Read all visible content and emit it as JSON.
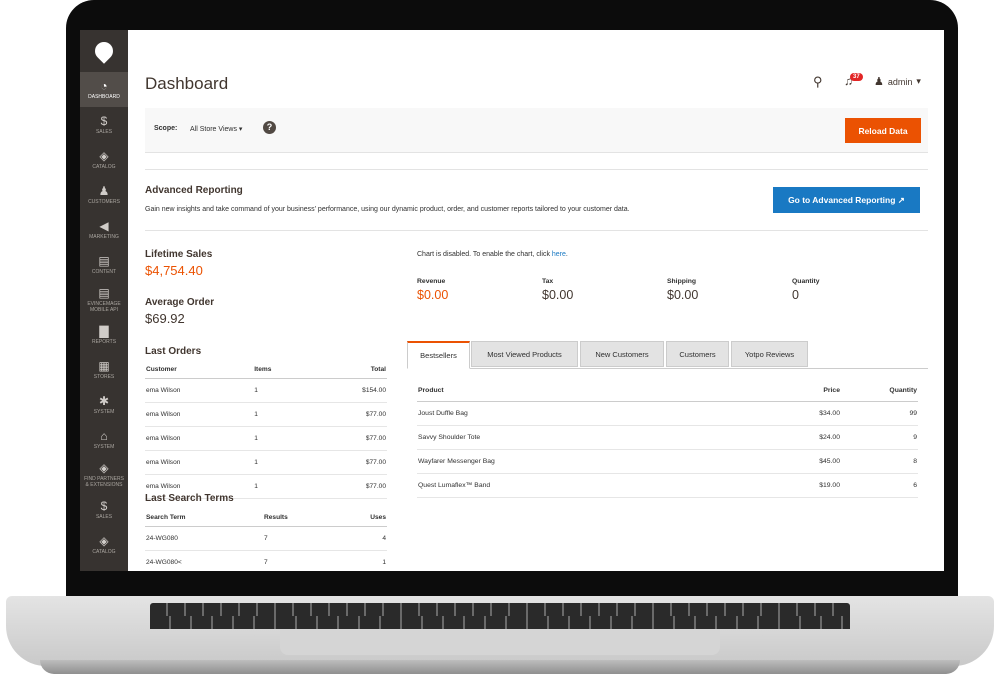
{
  "sidebar": {
    "items": [
      {
        "label": "DASHBOARD",
        "icon": "speedometer-icon",
        "glyph": "◔"
      },
      {
        "label": "SALES",
        "icon": "dollar-icon",
        "glyph": "$"
      },
      {
        "label": "CATALOG",
        "icon": "cube-icon",
        "glyph": "◈"
      },
      {
        "label": "CUSTOMERS",
        "icon": "person-icon",
        "glyph": "♟"
      },
      {
        "label": "MARKETING",
        "icon": "megaphone-icon",
        "glyph": "◀"
      },
      {
        "label": "CONTENT",
        "icon": "layout-icon",
        "glyph": "▤"
      },
      {
        "label": "EVINCEMAGE\nMOBILE API",
        "icon": "layout-icon",
        "glyph": "▤"
      },
      {
        "label": "REPORTS",
        "icon": "bar-chart-icon",
        "glyph": "▇"
      },
      {
        "label": "STORES",
        "icon": "store-icon",
        "glyph": "▦"
      },
      {
        "label": "SYSTEM",
        "icon": "gear-icon",
        "glyph": "✱"
      },
      {
        "label": "SYSTEM",
        "icon": "tower-icon",
        "glyph": "⌂"
      },
      {
        "label": "FIND PARTNERS\n& EXTENSIONS",
        "icon": "box-icon",
        "glyph": "◈"
      },
      {
        "label": "SALES",
        "icon": "dollar-icon",
        "glyph": "$"
      },
      {
        "label": "CATALOG",
        "icon": "cube-icon",
        "glyph": "◈"
      },
      {
        "label": "",
        "icon": "person-icon",
        "glyph": "♟"
      }
    ]
  },
  "header": {
    "title": "Dashboard",
    "notification_count": "37",
    "user": "admin"
  },
  "scope": {
    "label": "Scope:",
    "value": "All Store Views",
    "reload_label": "Reload Data"
  },
  "advanced": {
    "title": "Advanced Reporting",
    "description": "Gain new insights and take command of your business' performance, using our dynamic product, order, and customer reports tailored to your customer data.",
    "button_label": "Go to Advanced Reporting"
  },
  "stats": {
    "lifetime_label": "Lifetime Sales",
    "lifetime_value": "$4,754.40",
    "avg_label": "Average Order",
    "avg_value": "$69.92"
  },
  "last_orders": {
    "title": "Last Orders",
    "columns": [
      "Customer",
      "Items",
      "Total"
    ],
    "rows": [
      [
        "ema Wilson",
        "1",
        "$154.00"
      ],
      [
        "ema Wilson",
        "1",
        "$77.00"
      ],
      [
        "ema Wilson",
        "1",
        "$77.00"
      ],
      [
        "ema Wilson",
        "1",
        "$77.00"
      ],
      [
        "ema Wilson",
        "1",
        "$77.00"
      ]
    ]
  },
  "last_search": {
    "title": "Last Search Terms",
    "columns": [
      "Search Term",
      "Results",
      "Uses"
    ],
    "rows": [
      [
        "24-WG080",
        "7",
        "4"
      ],
      [
        "24-WG080<",
        "7",
        "1"
      ]
    ]
  },
  "chart": {
    "message": "Chart is disabled. To enable the chart, click ",
    "link": "here",
    "end": "."
  },
  "totals": [
    {
      "label": "Revenue",
      "value": "$0.00"
    },
    {
      "label": "Tax",
      "value": "$0.00"
    },
    {
      "label": "Shipping",
      "value": "$0.00"
    },
    {
      "label": "Quantity",
      "value": "0"
    }
  ],
  "tabs": [
    "Bestsellers",
    "Most Viewed Products",
    "New Customers",
    "Customers",
    "Yotpo Reviews"
  ],
  "bestsellers": {
    "columns": [
      "Product",
      "Price",
      "Quantity"
    ],
    "rows": [
      [
        "Joust Duffle Bag",
        "$34.00",
        "99"
      ],
      [
        "Savvy Shoulder Tote",
        "$24.00",
        "9"
      ],
      [
        "Wayfarer Messenger Bag",
        "$45.00",
        "8"
      ],
      [
        "Quest Lumaflex™ Band",
        "$19.00",
        "6"
      ]
    ]
  },
  "colors": {
    "accent": "#eb5202",
    "link": "#1979c3",
    "sidebar": "#373330"
  }
}
